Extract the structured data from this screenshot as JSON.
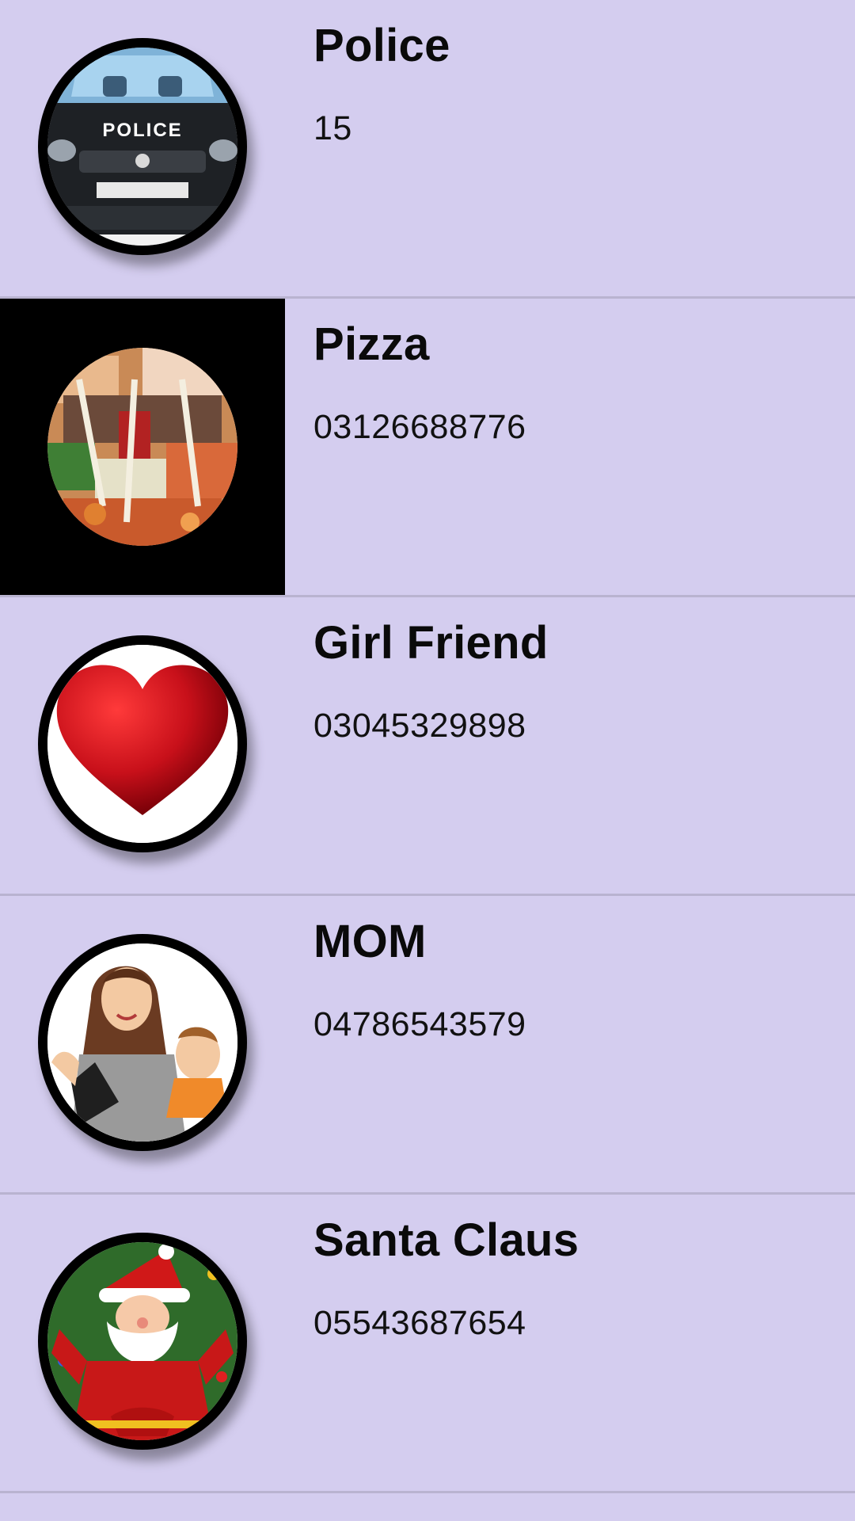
{
  "contacts": [
    {
      "name": "Police",
      "number": "15",
      "icon": "police-car-icon"
    },
    {
      "name": "Pizza",
      "number": "03126688776",
      "icon": "pizza-icon"
    },
    {
      "name": "Girl Friend",
      "number": "03045329898",
      "icon": "heart-icon"
    },
    {
      "name": "MOM",
      "number": "04786543579",
      "icon": "mom-icon"
    },
    {
      "name": "Santa Claus",
      "number": "05543687654",
      "icon": "santa-icon"
    }
  ],
  "police_label": "POLICE",
  "colors": {
    "background": "#d4cdef",
    "divider": "#b9b3d0",
    "heart": "#c8101a"
  }
}
